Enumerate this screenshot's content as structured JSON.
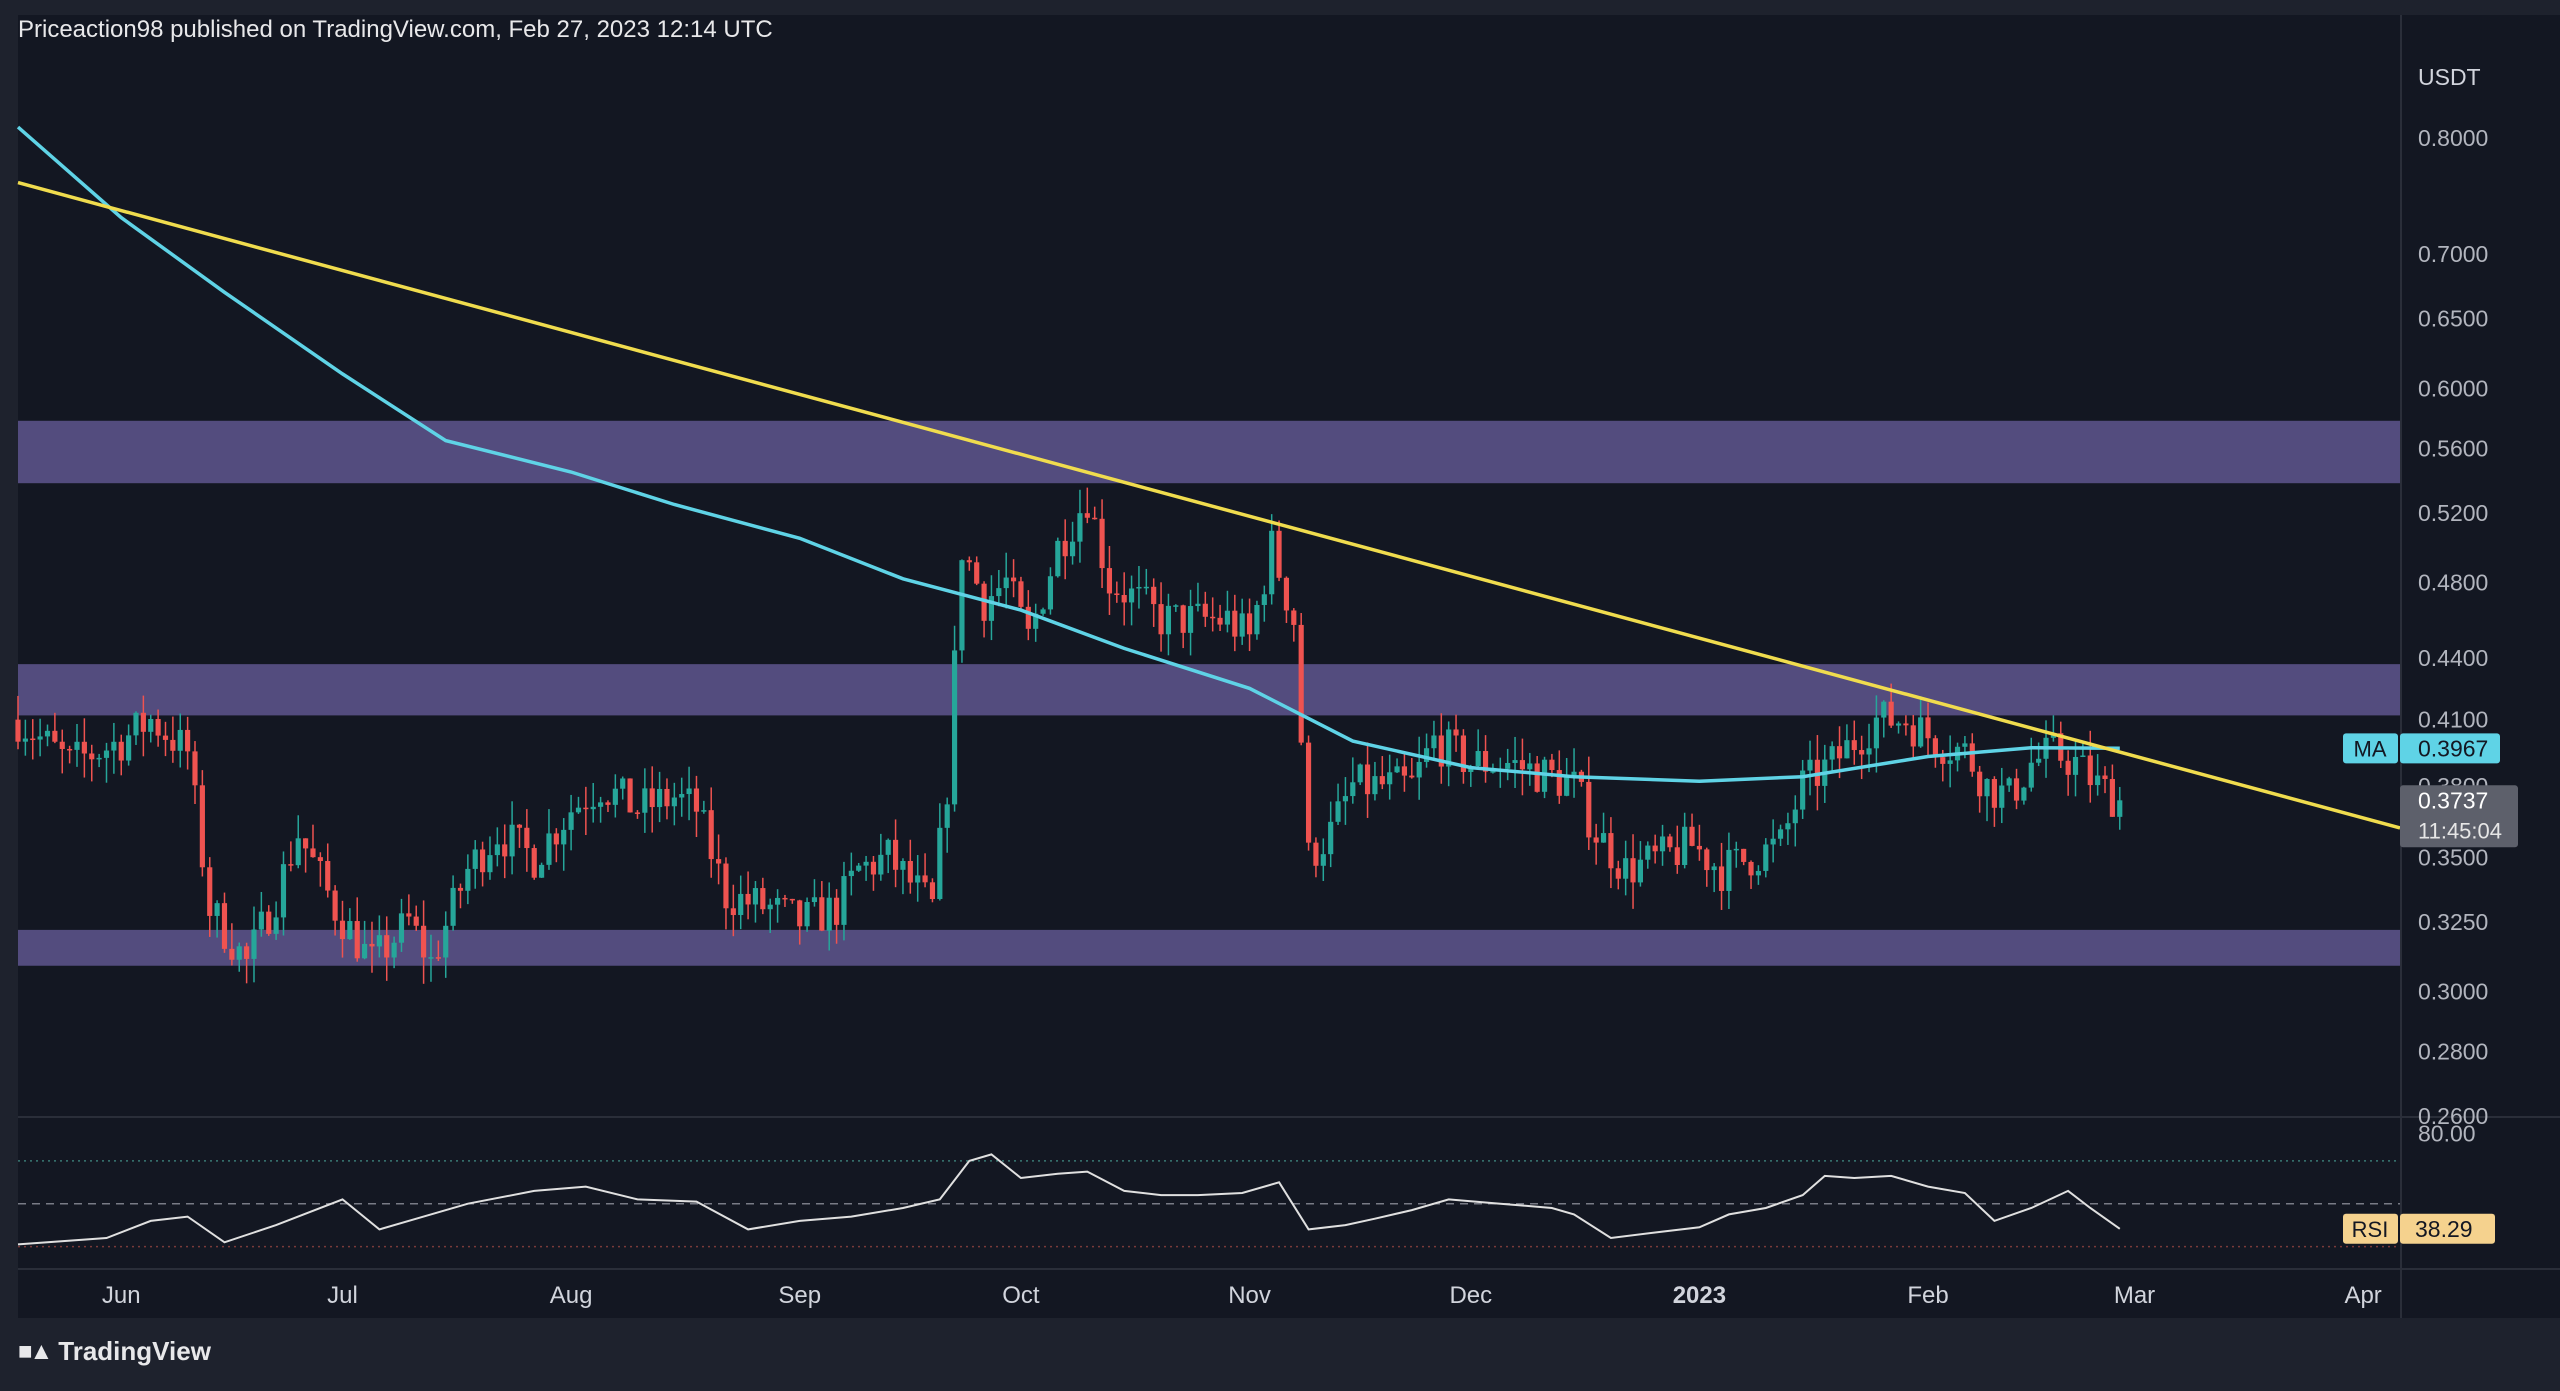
{
  "header": {
    "attribution": "Priceaction98 published on TradingView.com, Feb 27, 2023 12:14 UTC"
  },
  "footer": {
    "brand": "TradingView",
    "logo_icon": "tradingview-logo-icon"
  },
  "colors": {
    "background": "#131722",
    "frame": "#1e222d",
    "up": "#26a69a",
    "down": "#ef5350",
    "ma": "#5fd3e6",
    "trendline": "#f0dc4e",
    "zone": "#6a5f9e",
    "rsi": "#e0e0e0"
  },
  "chart_data": [
    {
      "type": "candlestick",
      "quote_currency": "USDT",
      "y_scale": "log",
      "ylim": [
        0.26,
        0.88
      ],
      "y_ticks": [
        "0.8000",
        "0.7000",
        "0.6500",
        "0.6000",
        "0.5600",
        "0.5200",
        "0.4800",
        "0.4400",
        "0.4100",
        "0.3800",
        "0.3500",
        "0.3250",
        "0.3000",
        "0.2800",
        "0.2600"
      ],
      "x_ticks": [
        {
          "label": "Jun",
          "date": "2022-06-01"
        },
        {
          "label": "Jul",
          "date": "2022-07-01"
        },
        {
          "label": "Aug",
          "date": "2022-08-01"
        },
        {
          "label": "Sep",
          "date": "2022-09-01"
        },
        {
          "label": "Oct",
          "date": "2022-10-01"
        },
        {
          "label": "Nov",
          "date": "2022-11-01"
        },
        {
          "label": "Dec",
          "date": "2022-12-01"
        },
        {
          "label": "2023",
          "date": "2023-01-01",
          "bold": true
        },
        {
          "label": "Feb",
          "date": "2023-02-01"
        },
        {
          "label": "Mar",
          "date": "2023-03-01"
        },
        {
          "label": "Apr",
          "date": "2023-04-01"
        }
      ],
      "x_range": [
        "2022-05-18",
        "2023-04-06"
      ],
      "close_path": [
        [
          "2022-05-18",
          0.41
        ],
        [
          "2022-05-25",
          0.39
        ],
        [
          "2022-06-01",
          0.4
        ],
        [
          "2022-06-05",
          0.41
        ],
        [
          "2022-06-10",
          0.395
        ],
        [
          "2022-06-13",
          0.33
        ],
        [
          "2022-06-18",
          0.31
        ],
        [
          "2022-06-22",
          0.335
        ],
        [
          "2022-06-25",
          0.36
        ],
        [
          "2022-06-30",
          0.33
        ],
        [
          "2022-07-05",
          0.31
        ],
        [
          "2022-07-10",
          0.325
        ],
        [
          "2022-07-13",
          0.31
        ],
        [
          "2022-07-18",
          0.345
        ],
        [
          "2022-07-22",
          0.36
        ],
        [
          "2022-07-27",
          0.35
        ],
        [
          "2022-08-01",
          0.37
        ],
        [
          "2022-08-05",
          0.38
        ],
        [
          "2022-08-10",
          0.37
        ],
        [
          "2022-08-15",
          0.375
        ],
        [
          "2022-08-18",
          0.37
        ],
        [
          "2022-08-22",
          0.335
        ],
        [
          "2022-08-28",
          0.33
        ],
        [
          "2022-09-01",
          0.325
        ],
        [
          "2022-09-06",
          0.33
        ],
        [
          "2022-09-09",
          0.345
        ],
        [
          "2022-09-13",
          0.35
        ],
        [
          "2022-09-16",
          0.34
        ],
        [
          "2022-09-19",
          0.33
        ],
        [
          "2022-09-21",
          0.38
        ],
        [
          "2022-09-23",
          0.5
        ],
        [
          "2022-09-26",
          0.47
        ],
        [
          "2022-09-29",
          0.48
        ],
        [
          "2022-10-02",
          0.45
        ],
        [
          "2022-10-06",
          0.5
        ],
        [
          "2022-10-10",
          0.53
        ],
        [
          "2022-10-13",
          0.48
        ],
        [
          "2022-10-17",
          0.47
        ],
        [
          "2022-10-20",
          0.46
        ],
        [
          "2022-10-25",
          0.46
        ],
        [
          "2022-10-29",
          0.46
        ],
        [
          "2022-11-01",
          0.45
        ],
        [
          "2022-11-04",
          0.5
        ],
        [
          "2022-11-07",
          0.46
        ],
        [
          "2022-11-09",
          0.35
        ],
        [
          "2022-11-12",
          0.36
        ],
        [
          "2022-11-15",
          0.38
        ],
        [
          "2022-11-19",
          0.38
        ],
        [
          "2022-11-23",
          0.38
        ],
        [
          "2022-11-26",
          0.4
        ],
        [
          "2022-12-01",
          0.39
        ],
        [
          "2022-12-06",
          0.39
        ],
        [
          "2022-12-11",
          0.385
        ],
        [
          "2022-12-15",
          0.38
        ],
        [
          "2022-12-18",
          0.36
        ],
        [
          "2022-12-22",
          0.345
        ],
        [
          "2022-12-27",
          0.35
        ],
        [
          "2022-12-31",
          0.355
        ],
        [
          "2023-01-04",
          0.345
        ],
        [
          "2023-01-08",
          0.35
        ],
        [
          "2023-01-12",
          0.355
        ],
        [
          "2023-01-15",
          0.38
        ],
        [
          "2023-01-19",
          0.39
        ],
        [
          "2023-01-22",
          0.4
        ],
        [
          "2023-01-25",
          0.41
        ],
        [
          "2023-01-29",
          0.41
        ],
        [
          "2023-02-02",
          0.4
        ],
        [
          "2023-02-06",
          0.395
        ],
        [
          "2023-02-09",
          0.38
        ],
        [
          "2023-02-12",
          0.375
        ],
        [
          "2023-02-15",
          0.39
        ],
        [
          "2023-02-18",
          0.395
        ],
        [
          "2023-02-21",
          0.39
        ],
        [
          "2023-02-24",
          0.38
        ],
        [
          "2023-02-27",
          0.3737
        ]
      ],
      "support_resistance_zones": [
        {
          "low": 0.538,
          "high": 0.578
        },
        {
          "low": 0.412,
          "high": 0.437
        },
        {
          "low": 0.309,
          "high": 0.322
        }
      ],
      "trendline": {
        "start": {
          "date": "2022-05-18",
          "price": 0.76
        },
        "end": {
          "date": "2023-04-06",
          "price": 0.362
        }
      },
      "moving_average": {
        "name": "MA",
        "last_value": "0.3967",
        "path": [
          [
            "2022-05-18",
            0.81
          ],
          [
            "2022-06-01",
            0.73
          ],
          [
            "2022-06-15",
            0.67
          ],
          [
            "2022-07-01",
            0.61
          ],
          [
            "2022-07-15",
            0.565
          ],
          [
            "2022-08-01",
            0.545
          ],
          [
            "2022-08-15",
            0.525
          ],
          [
            "2022-09-01",
            0.505
          ],
          [
            "2022-09-15",
            0.482
          ],
          [
            "2022-10-01",
            0.465
          ],
          [
            "2022-10-15",
            0.445
          ],
          [
            "2022-11-01",
            0.425
          ],
          [
            "2022-11-15",
            0.4
          ],
          [
            "2022-12-01",
            0.388
          ],
          [
            "2022-12-15",
            0.384
          ],
          [
            "2023-01-01",
            0.382
          ],
          [
            "2023-01-15",
            0.384
          ],
          [
            "2023-02-01",
            0.393
          ],
          [
            "2023-02-15",
            0.397
          ],
          [
            "2023-02-27",
            0.3967
          ]
        ]
      },
      "last_price": {
        "value": "0.3737",
        "countdown": "11:45:04"
      }
    },
    {
      "type": "line",
      "name": "RSI",
      "last_value": "38.29",
      "ylim": [
        20,
        90
      ],
      "y_ticks": [
        "80.00"
      ],
      "levels": [
        70,
        50,
        30
      ],
      "path": [
        [
          "2022-05-18",
          31
        ],
        [
          "2022-05-30",
          34
        ],
        [
          "2022-06-05",
          42
        ],
        [
          "2022-06-10",
          44
        ],
        [
          "2022-06-15",
          32
        ],
        [
          "2022-06-22",
          40
        ],
        [
          "2022-07-01",
          52
        ],
        [
          "2022-07-06",
          38
        ],
        [
          "2022-07-12",
          44
        ],
        [
          "2022-07-18",
          50
        ],
        [
          "2022-07-27",
          56
        ],
        [
          "2022-08-03",
          58
        ],
        [
          "2022-08-10",
          52
        ],
        [
          "2022-08-18",
          51
        ],
        [
          "2022-08-25",
          38
        ],
        [
          "2022-09-01",
          42
        ],
        [
          "2022-09-08",
          44
        ],
        [
          "2022-09-15",
          48
        ],
        [
          "2022-09-20",
          52
        ],
        [
          "2022-09-24",
          70
        ],
        [
          "2022-09-27",
          73
        ],
        [
          "2022-10-01",
          62
        ],
        [
          "2022-10-06",
          64
        ],
        [
          "2022-10-10",
          65
        ],
        [
          "2022-10-15",
          56
        ],
        [
          "2022-10-20",
          54
        ],
        [
          "2022-10-25",
          54
        ],
        [
          "2022-10-31",
          55
        ],
        [
          "2022-11-05",
          60
        ],
        [
          "2022-11-09",
          38
        ],
        [
          "2022-11-14",
          40
        ],
        [
          "2022-11-18",
          43
        ],
        [
          "2022-11-23",
          47
        ],
        [
          "2022-11-28",
          52
        ],
        [
          "2022-12-05",
          50
        ],
        [
          "2022-12-12",
          48
        ],
        [
          "2022-12-15",
          45
        ],
        [
          "2022-12-20",
          34
        ],
        [
          "2022-12-27",
          37
        ],
        [
          "2023-01-01",
          39
        ],
        [
          "2023-01-05",
          45
        ],
        [
          "2023-01-10",
          48
        ],
        [
          "2023-01-15",
          54
        ],
        [
          "2023-01-18",
          63
        ],
        [
          "2023-01-22",
          62
        ],
        [
          "2023-01-27",
          63
        ],
        [
          "2023-02-01",
          58
        ],
        [
          "2023-02-06",
          55
        ],
        [
          "2023-02-10",
          42
        ],
        [
          "2023-02-15",
          48
        ],
        [
          "2023-02-20",
          56
        ],
        [
          "2023-02-23",
          48
        ],
        [
          "2023-02-27",
          38.29
        ]
      ]
    }
  ]
}
